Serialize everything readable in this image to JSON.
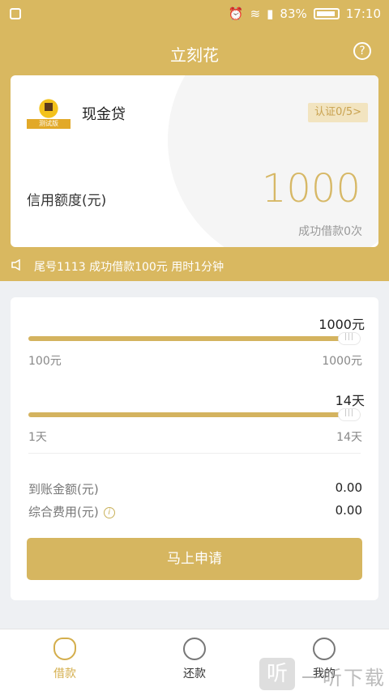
{
  "status_bar": {
    "battery": "83%",
    "time": "17:10"
  },
  "header": {
    "title": "立刻花"
  },
  "product": {
    "name": "现金贷",
    "logo_tag": "测试版",
    "auth_label": "认证0/5>",
    "credit_label": "信用额度(元)",
    "credit_value": "1000",
    "success_count": "成功借款0次"
  },
  "notice": {
    "text": "尾号1113 成功借款100元 用时1分钟"
  },
  "amount": {
    "value": "1000元",
    "min": "100元",
    "max": "1000元",
    "level": 1.0
  },
  "days": {
    "value": "14天",
    "min": "1天",
    "max": "14天",
    "level": 1.0
  },
  "fees": {
    "received_label": "到账金额(元)",
    "received_value": "0.00",
    "total_label": "综合费用(元)",
    "total_value": "0.00"
  },
  "apply_label": "马上申请",
  "tabs": [
    {
      "label": "借款",
      "icon": "money-bag-icon"
    },
    {
      "label": "还款",
      "icon": "refund-icon"
    },
    {
      "label": "我的",
      "icon": "user-icon"
    }
  ],
  "watermark": {
    "logo": "听",
    "text": "一听下载"
  },
  "colors": {
    "accent": "#d9b860",
    "credit": "#d7b866"
  }
}
